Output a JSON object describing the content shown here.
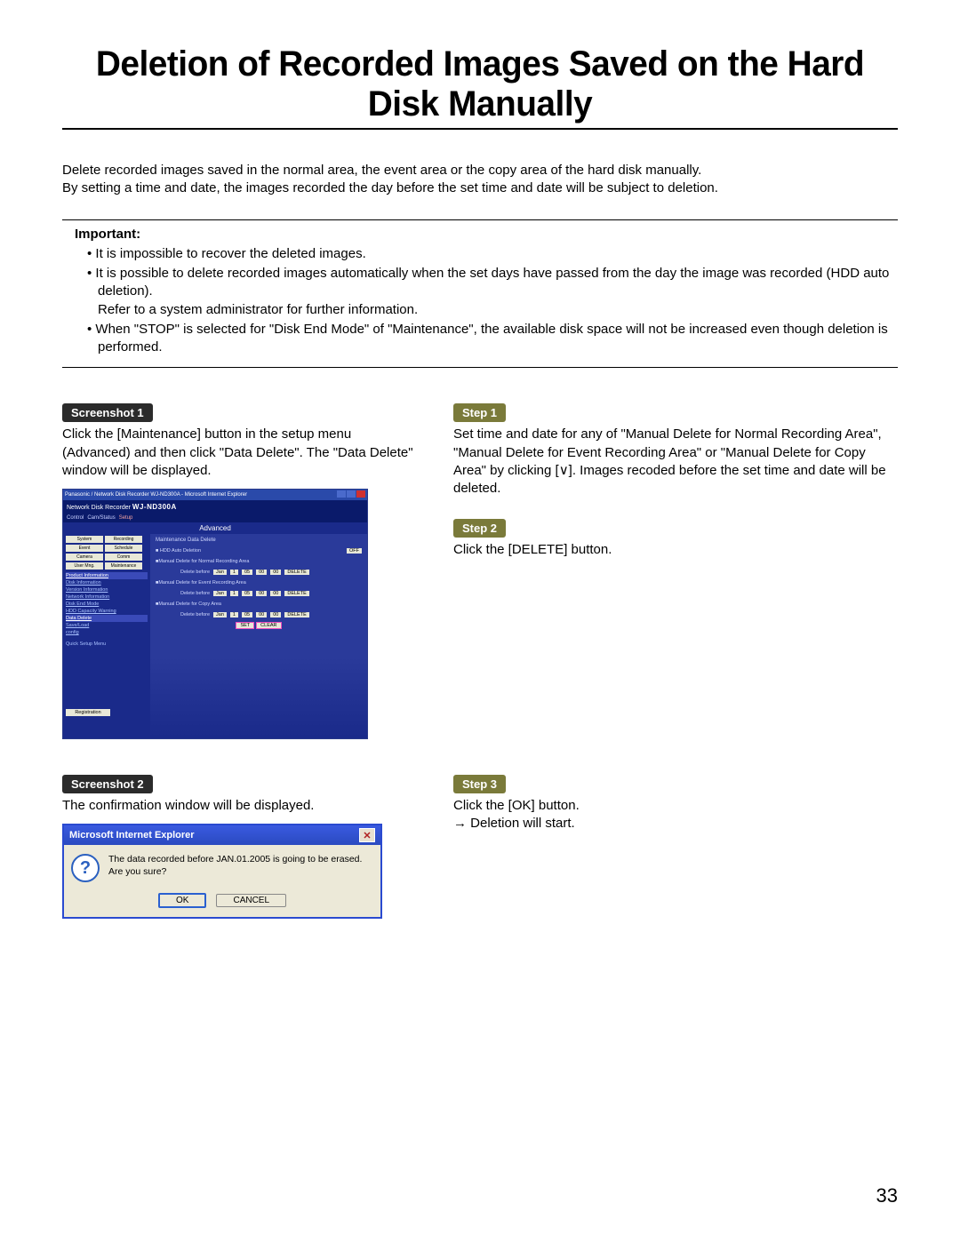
{
  "title": "Deletion of Recorded Images Saved on the Hard Disk Manually",
  "intro": "Delete recorded images saved in the normal area, the event area or the copy area of the hard disk manually.\nBy setting a time and date, the images recorded the day before the set time and date will be subject to deletion.",
  "important_label": "Important:",
  "important_items": [
    "It is impossible to recover the deleted images.",
    "It is possible to delete recorded images automatically when the set days have passed from the day the image was recorded (HDD auto deletion).\nRefer to a system administrator for further information.",
    "When \"STOP\" is selected for \"Disk End Mode\" of \"Maintenance\", the available disk space will not be increased even though deletion is performed."
  ],
  "screenshot1_badge": "Screenshot 1",
  "screenshot1_text": "Click the [Maintenance] button in the setup menu (Advanced) and then click \"Data Delete\". The \"Data Delete\" window will be displayed.",
  "screenshot2_badge": "Screenshot 2",
  "screenshot2_text": "The confirmation window will be displayed.",
  "step1_badge": "Step 1",
  "step1_text": "Set time and date for any of \"Manual Delete for Normal Recording Area\", \"Manual Delete for Event Recording Area\" or \"Manual Delete for Copy Area\" by clicking [∨]. Images recoded before the set time and date will be deleted.",
  "step2_badge": "Step 2",
  "step2_text": "Click the [DELETE] button.",
  "step3_badge": "Step 3",
  "step3_line1": "Click the [OK] button.",
  "step3_line2": "→ Deletion will start.",
  "shot1": {
    "ie_title": "Panasonic / Network Disk Recorder WJ-ND300A - Microsoft Internet Explorer",
    "header_prefix": "Network Disk Recorder",
    "model": "WJ-ND300A",
    "mode_control": "Control",
    "mode_download": "Cam/Status",
    "mode_setup": "Setup",
    "advanced": "Advanced",
    "btn_system": "System",
    "btn_recording": "Recording",
    "btn_event": "Event",
    "btn_schedule": "Schedule",
    "btn_camera": "Camera",
    "btn_comm": "Comm",
    "btn_user": "User Mng.",
    "btn_maint": "Maintenance",
    "side_product": "Product Information",
    "side_disk": "Disk Information",
    "side_version": "Version Information",
    "side_network": "Network Information",
    "side_diskend": "Disk End Mode",
    "side_hddcap": "HDD Capacity Warning",
    "side_datadel": "Data Delete",
    "side_savelog": "Save/Load",
    "side_config": "config",
    "quick": "Quick Setup Menu",
    "registration": "Registration",
    "crumb": "Maintenance    Data Delete",
    "row_auto": "■ HDD Auto Deletion",
    "row_auto_val": "OFF",
    "row_normal": "■Manual Delete for Normal Recording Area",
    "row_event": "■Manual Delete for Event Recording Area",
    "row_copy": "■Manual Delete for Copy Area",
    "delete_before": "Delete before",
    "mon": "Jan",
    "day": "1",
    "yr": "05",
    "hr": "00",
    "mn": "00",
    "delete_btn": "DELETE",
    "set": "SET",
    "clear": "CLEAR"
  },
  "shot2": {
    "title": "Microsoft Internet Explorer",
    "msg": "The data recorded before JAN.01.2005 is going to be erased. Are you sure?",
    "ok": "OK",
    "cancel": "CANCEL"
  },
  "page_number": "33"
}
